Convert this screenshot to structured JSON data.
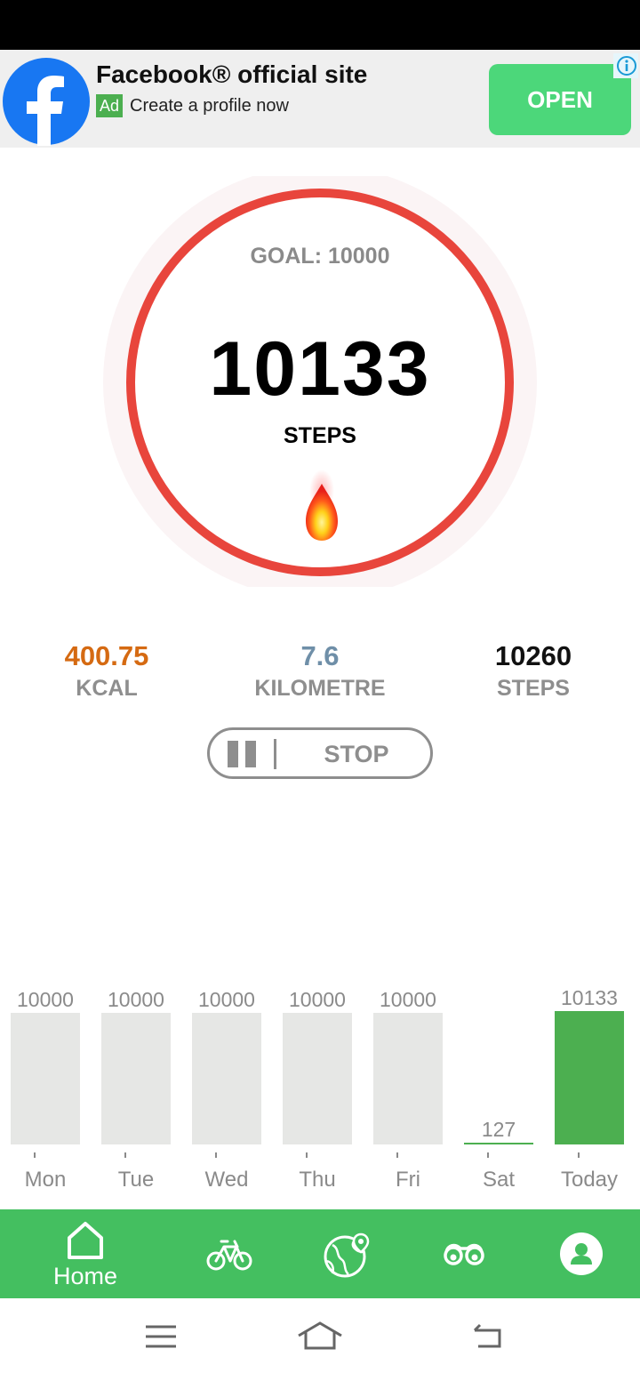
{
  "ad": {
    "title": "Facebook® official site",
    "badge": "Ad",
    "subtitle": "Create a profile now",
    "open_label": "OPEN",
    "brand_color": "#1877f2",
    "button_color": "#4cd77a"
  },
  "ring": {
    "goal_text": "GOAL: 10000",
    "steps": "10133",
    "steps_label": "STEPS",
    "progress": 1.0,
    "ring_color": "#e8453c",
    "flame_icon": "flame-icon"
  },
  "stats": {
    "kcal_value": "400.75",
    "kcal_label": "KCAL",
    "km_value": "7.6",
    "km_label": "KILOMETRE",
    "steps_value": "10260",
    "steps_label": "STEPS",
    "kcal_color": "#d56a12",
    "km_color": "#6f8fa8",
    "steps_color": "#111111"
  },
  "control": {
    "stop_label": "STOP",
    "pause_icon": "pause-icon"
  },
  "chart_data": {
    "type": "bar",
    "categories": [
      "Mon",
      "Tue",
      "Wed",
      "Thu",
      "Fri",
      "Sat",
      "Today"
    ],
    "values": [
      10000,
      10000,
      10000,
      10000,
      10000,
      127,
      10133
    ],
    "value_labels": [
      "10000",
      "10000",
      "10000",
      "10000",
      "10000",
      "127",
      "10133"
    ],
    "goal": 10000,
    "title": "",
    "xlabel": "",
    "ylabel": "",
    "ylim": [
      0,
      10133
    ],
    "grid": false,
    "legend": "none",
    "colors": {
      "past": "#e6e7e5",
      "today": "#4caf50",
      "partial": "#4caf50"
    }
  },
  "nav": {
    "home_label": "Home",
    "accent": "#44bf60",
    "items": [
      "home-icon",
      "bicycle-icon",
      "globe-map-icon",
      "binoculars-icon",
      "profile-icon"
    ]
  },
  "system_nav": {
    "items": [
      "menu-icon",
      "home-outline-icon",
      "back-icon"
    ]
  }
}
